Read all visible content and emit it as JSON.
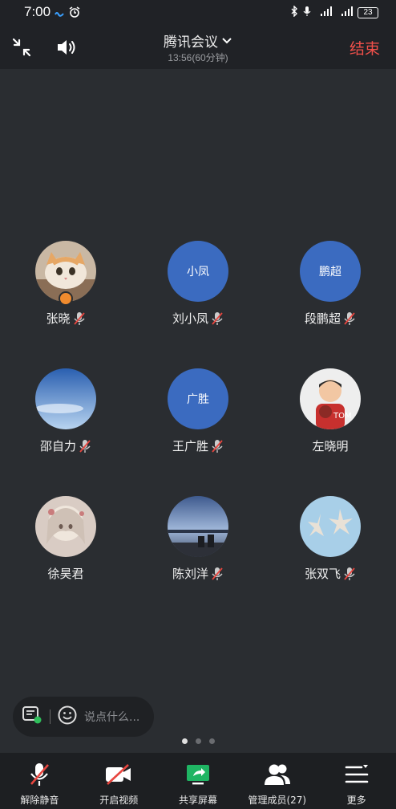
{
  "status_bar": {
    "time": "7:00",
    "battery": "23"
  },
  "header": {
    "title": "腾讯会议",
    "time": "13:56(60分钟)",
    "end_label": "结束"
  },
  "participants": [
    {
      "name": "张晓",
      "avatar": "photo-cat",
      "muted": true,
      "host": true
    },
    {
      "name": "刘小凤",
      "avatar_text": "小凤",
      "muted": true
    },
    {
      "name": "段鹏超",
      "avatar_text": "鹏超",
      "muted": true
    },
    {
      "name": "邵自力",
      "avatar": "photo-sky",
      "muted": true
    },
    {
      "name": "王广胜",
      "avatar_text": "广胜",
      "muted": true
    },
    {
      "name": "左晓明",
      "avatar": "photo-child",
      "muted": false
    },
    {
      "name": "徐昊君",
      "avatar": "photo-anime",
      "muted": false
    },
    {
      "name": "陈刘洋",
      "avatar": "photo-lake",
      "muted": true
    },
    {
      "name": "张双飞",
      "avatar": "photo-starfish",
      "muted": true
    }
  ],
  "chat": {
    "placeholder": "说点什么..."
  },
  "pager": {
    "pages": 3,
    "current": 1
  },
  "toolbar": {
    "unmute": "解除静音",
    "video": "开启视频",
    "share": "共享屏幕",
    "members": "管理成员(27)",
    "more": "更多"
  },
  "colors": {
    "accent_end": "#f0504a",
    "avatar_blue": "#3b6bc0",
    "share_green": "#1fb563"
  }
}
